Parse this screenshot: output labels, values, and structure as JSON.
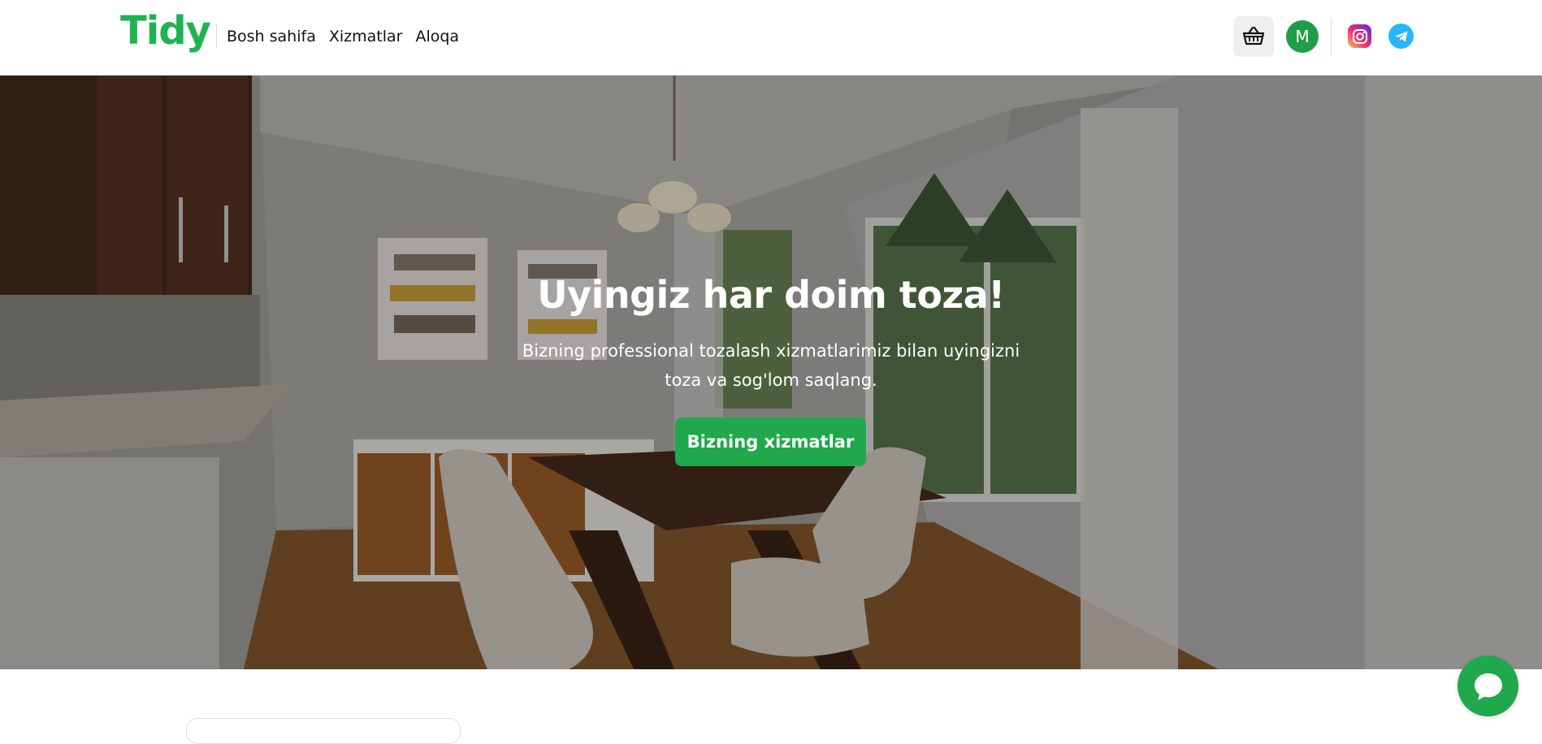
{
  "brand": {
    "name": "Tidy",
    "color": "#1fb350"
  },
  "nav": {
    "items": [
      {
        "label": "Bosh sahifa"
      },
      {
        "label": "Xizmatlar"
      },
      {
        "label": "Aloqa"
      }
    ]
  },
  "header": {
    "cart_icon": "basket-icon",
    "avatar_initial": "M",
    "social": [
      {
        "name": "instagram-icon"
      },
      {
        "name": "telegram-icon"
      }
    ]
  },
  "hero": {
    "title": "Uyingiz har doim toza!",
    "subtitle": "Bizning professional tozalash xizmatlarimiz bilan uyingizni toza va sog'lom saqlang.",
    "cta_label": "Bizning xizmatlar",
    "background": "dining-room-photo"
  },
  "chat": {
    "icon": "chat-bubble-icon"
  },
  "colors": {
    "accent": "#1fa84c",
    "avatar": "#1f9d47",
    "telegram": "#29b6f6"
  }
}
